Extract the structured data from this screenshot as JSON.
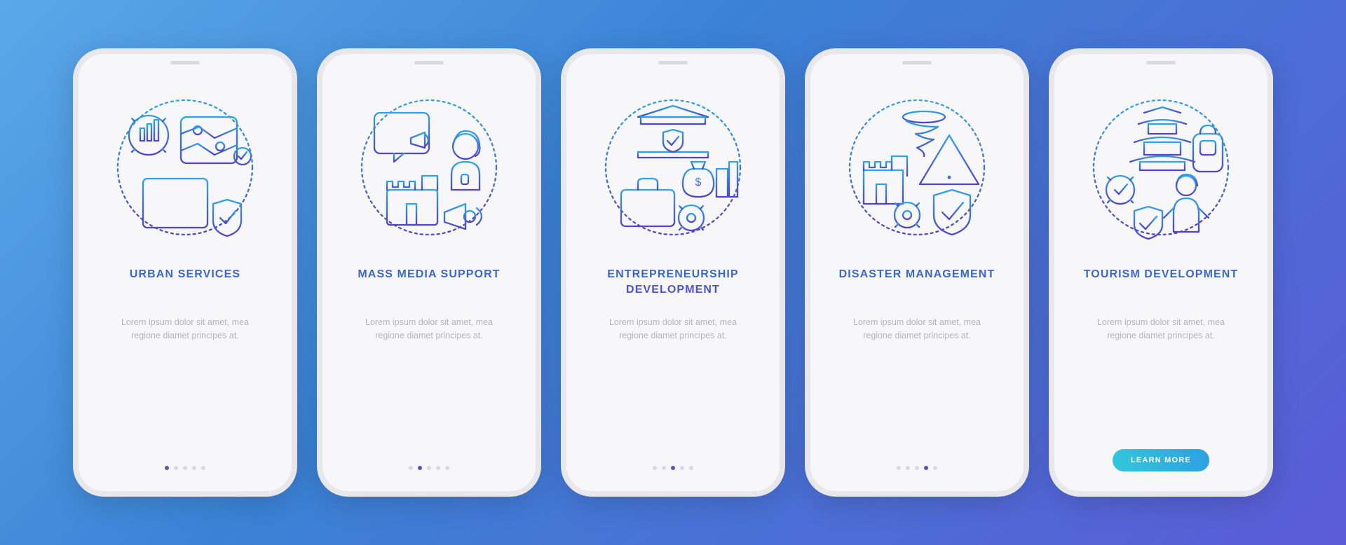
{
  "common_body": "Lorem ipsum dolor sit amet, mea regione diamet principes at.",
  "cta_label": "LEARN MORE",
  "slides": [
    {
      "title": "URBAN SERVICES",
      "icon": "urban-services-icon",
      "active_dot": 0
    },
    {
      "title": "MASS MEDIA SUPPORT",
      "icon": "mass-media-icon",
      "active_dot": 1
    },
    {
      "title": "ENTREPRENEURSHIP DEVELOPMENT",
      "icon": "entrepreneurship-icon",
      "active_dot": 2
    },
    {
      "title": "DISASTER MANAGEMENT",
      "icon": "disaster-management-icon",
      "active_dot": 3
    },
    {
      "title": "TOURISM DEVELOPMENT",
      "icon": "tourism-icon",
      "active_dot": 4
    }
  ],
  "total_dots": 5
}
